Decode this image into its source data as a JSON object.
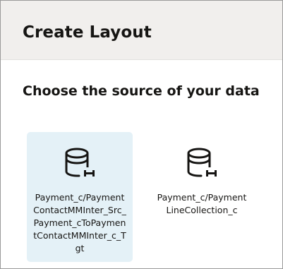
{
  "dialog": {
    "title": "Create Layout",
    "section_heading": "Choose the source of your data"
  },
  "sources": [
    {
      "label": "Payment_c/PaymentContactMMInter_Src_Payment_cToPaymentContactMMInter_c_Tgt",
      "icon": "database-link-icon",
      "selected": true
    },
    {
      "label": "Payment_c/PaymentLineCollection_c",
      "icon": "database-link-icon",
      "selected": false
    }
  ],
  "colors": {
    "header_bg": "#f1efed",
    "selected_card_bg": "#e4f1f7",
    "text": "#161513"
  }
}
